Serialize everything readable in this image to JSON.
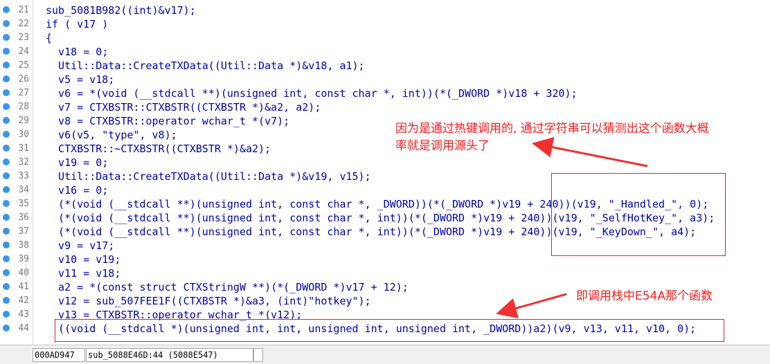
{
  "code_lines": [
    {
      "num": "21",
      "text": "sub_5081B982((int)&v17);"
    },
    {
      "num": "22",
      "text": "if ( v17 )"
    },
    {
      "num": "23",
      "text": "{"
    },
    {
      "num": "24",
      "text": "  v18 = 0;"
    },
    {
      "num": "25",
      "text": "  Util::Data::CreateTXData((Util::Data *)&v18, a1);"
    },
    {
      "num": "26",
      "text": "  v5 = v18;"
    },
    {
      "num": "27",
      "text": "  v6 = *(void (__stdcall **)(unsigned int, const char *, int))(*(_DWORD *)v18 + 320);"
    },
    {
      "num": "28",
      "text": "  v7 = CTXBSTR::CTXBSTR((CTXBSTR *)&a2, a2);"
    },
    {
      "num": "29",
      "text": "  v8 = CTXBSTR::operator wchar_t *(v7);"
    },
    {
      "num": "30",
      "text": "  v6(v5, \"type\", v8);"
    },
    {
      "num": "31",
      "text": "  CTXBSTR::~CTXBSTR((CTXBSTR *)&a2);"
    },
    {
      "num": "32",
      "text": "  v19 = 0;"
    },
    {
      "num": "33",
      "text": "  Util::Data::CreateTXData((Util::Data *)&v19, v15);"
    },
    {
      "num": "34",
      "text": "  v16 = 0;"
    },
    {
      "num": "35",
      "text": "  (*(void (__stdcall **)(unsigned int, const char *, _DWORD))(*(_DWORD *)v19 + 240))(v19, \"_Handled_\", 0);"
    },
    {
      "num": "36",
      "text": "  (*(void (__stdcall **)(unsigned int, const char *, int))(*(_DWORD *)v19 + 240))(v19, \"_SelfHotKey_\", a3);"
    },
    {
      "num": "37",
      "text": "  (*(void (__stdcall **)(unsigned int, const char *, int))(*(_DWORD *)v19 + 240))(v19, \"_KeyDown_\", a4);"
    },
    {
      "num": "38",
      "text": "  v9 = v17;"
    },
    {
      "num": "39",
      "text": "  v10 = v19;"
    },
    {
      "num": "40",
      "text": "  v11 = v18;"
    },
    {
      "num": "41",
      "text": "  a2 = *(const struct CTXStringW **)(*(_DWORD *)v17 + 12);"
    },
    {
      "num": "42",
      "text": "  v12 = sub_507FEE1F((CTXBSTR *)&a3, (int)\"hotkey\");"
    },
    {
      "num": "43",
      "text": "  v13 = CTXBSTR::operator wchar_t *(v12);"
    },
    {
      "num": "44",
      "text": "  ((void (__stdcall *)(unsigned int, int, unsigned int, unsigned int, _DWORD))a2)(v9, v13, v11, v10, 0);"
    }
  ],
  "annotations": {
    "note1_line1": "因为是通过热键调用的, 通过字符串可以猜测出这个函数大概",
    "note1_line2": "率就是调用源头了",
    "note2": "即调用栈中E54A那个函数"
  },
  "statusbar": {
    "address": "000AD947",
    "location": "sub_5088E46D:44 (5088E547)"
  },
  "colors": {
    "keyword": "#0000b0",
    "function": "#a0007a",
    "string": "#008000",
    "number": "#0000b0",
    "annotation": "#ff1a1a",
    "gutter_dot": "#3b95e8"
  }
}
